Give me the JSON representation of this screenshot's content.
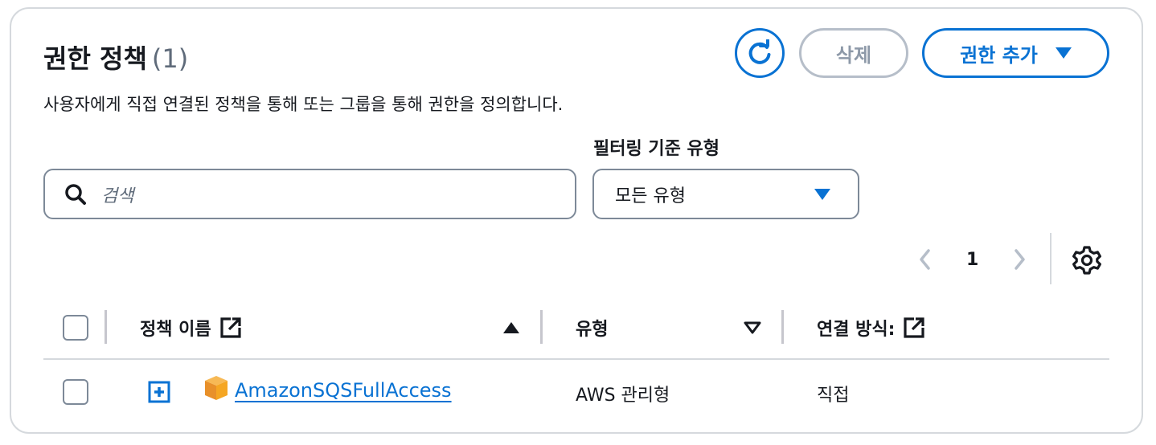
{
  "panel": {
    "title": "권한 정책",
    "count": "(1)",
    "description": "사용자에게 직접 연결된 정책을 통해 또는 그룹을 통해 권한을 정의합니다."
  },
  "actions": {
    "refresh_icon": "refresh-icon",
    "delete_label": "삭제",
    "add_label": "권한 추가"
  },
  "filter": {
    "label": "필터링 기준 유형",
    "search_placeholder": "검색",
    "select_value": "모든 유형"
  },
  "pagination": {
    "current_page": "1"
  },
  "table": {
    "columns": [
      {
        "label": "정책 이름",
        "sort": "ascending",
        "external_link": true
      },
      {
        "label": "유형",
        "sort": "sortable"
      },
      {
        "label": "연결 방식:",
        "external_link": true
      }
    ],
    "rows": [
      {
        "policy_name": "AmazonSQSFullAccess",
        "type": "AWS 관리형",
        "attached_via": "직접"
      }
    ]
  },
  "colors": {
    "accent": "#0972d3",
    "disabled": "#8d99a8",
    "border": "#7d8998",
    "policy_icon": "#f5a623"
  }
}
